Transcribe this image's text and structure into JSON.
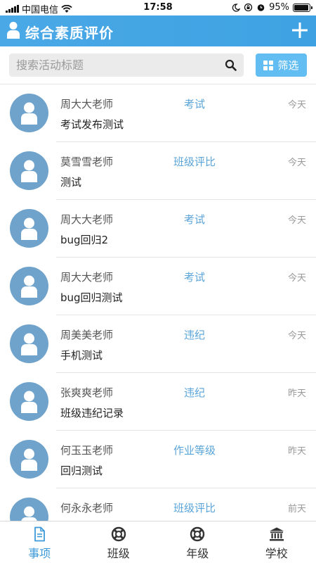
{
  "status_bar": {
    "carrier": "中国电信",
    "time": "17:58",
    "battery_percent": "95%",
    "battery_level": 0.95
  },
  "header": {
    "title": "综合素质评价",
    "add_icon": "plus-icon",
    "user_icon": "user-icon"
  },
  "search": {
    "placeholder": "搜索活动标题",
    "value": "",
    "filter_label": "筛选"
  },
  "colors": {
    "header_bg": "#41a4e4",
    "accent": "#3d9ad8",
    "category": "#5aa4d8",
    "avatar_bg": "#6fa3cb",
    "filter_bg": "#62bdf2"
  },
  "items": [
    {
      "teacher": "周大大老师",
      "category": "考试",
      "date": "今天",
      "title": "考试发布测试"
    },
    {
      "teacher": "莫雪雪老师",
      "category": "班级评比",
      "date": "今天",
      "title": "测试"
    },
    {
      "teacher": "周大大老师",
      "category": "考试",
      "date": "今天",
      "title": "bug回归2"
    },
    {
      "teacher": "周大大老师",
      "category": "考试",
      "date": "今天",
      "title": "bug回归测试"
    },
    {
      "teacher": "周美美老师",
      "category": "违纪",
      "date": "今天",
      "title": "手机测试"
    },
    {
      "teacher": "张爽爽老师",
      "category": "违纪",
      "date": "昨天",
      "title": "班级违纪记录"
    },
    {
      "teacher": "何玉玉老师",
      "category": "作业等级",
      "date": "昨天",
      "title": "回归测试"
    },
    {
      "teacher": "何永永老师",
      "category": "班级评比",
      "date": "前天",
      "title": ""
    }
  ],
  "tabs": [
    {
      "label": "事项",
      "icon": "document-icon",
      "active": true
    },
    {
      "label": "班级",
      "icon": "lifebuoy-icon",
      "active": false
    },
    {
      "label": "年级",
      "icon": "lifebuoy-icon",
      "active": false
    },
    {
      "label": "学校",
      "icon": "school-building-icon",
      "active": false
    }
  ]
}
